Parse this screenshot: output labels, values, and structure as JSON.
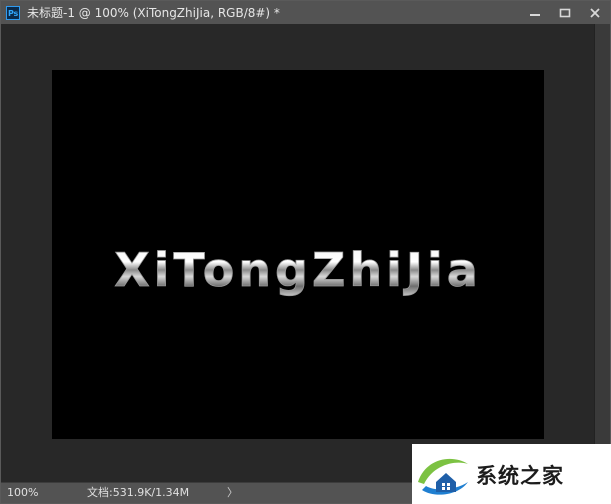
{
  "window": {
    "app_badge": "Ps",
    "title": "未标题-1 @ 100% (XiTongZhiJia, RGB/8#) *"
  },
  "canvas": {
    "text": "XiTongZhiJia",
    "background": "#000000"
  },
  "status": {
    "zoom": "100%",
    "doc_info": "文档:531.9K/1.34M",
    "arrow": "〉"
  },
  "watermark": {
    "text": "系统之家"
  },
  "icons": {
    "minimize": "minimize-icon",
    "restore": "restore-icon",
    "close": "close-icon",
    "logo": "house-logo-icon"
  },
  "colors": {
    "titlebar": "#535353",
    "workspace": "#282828",
    "ps_blue": "#31a8ff"
  }
}
